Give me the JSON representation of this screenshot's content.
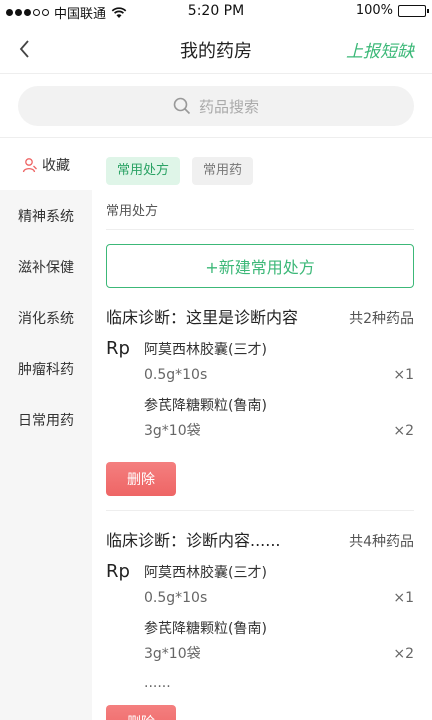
{
  "status": {
    "carrier": "中国联通",
    "time": "5:20 PM",
    "battery": "100%"
  },
  "nav": {
    "title": "我的药房",
    "report": "上报短缺"
  },
  "search": {
    "placeholder": "药品搜索"
  },
  "sidebar": {
    "items": [
      {
        "label": "收藏",
        "active": true
      },
      {
        "label": "精神系统"
      },
      {
        "label": "滋补保健"
      },
      {
        "label": "消化系统"
      },
      {
        "label": "肿瘤科药"
      },
      {
        "label": "日常用药"
      }
    ]
  },
  "tabs": [
    {
      "label": "常用处方"
    },
    {
      "label": "常用药"
    }
  ],
  "section_label": "常用处方",
  "new_button": "+新建常用处方",
  "cards": [
    {
      "diagnosis": "临床诊断：这里是诊断内容",
      "count": "共2种药品",
      "rp": "Rp",
      "drugs": [
        {
          "name": "阿莫西林胶囊(三才)",
          "spec": "0.5g*10s",
          "qty": "×1"
        },
        {
          "name": "参芪降糖颗粒(鲁南)",
          "spec": "3g*10袋",
          "qty": "×2"
        }
      ],
      "delete": "删除"
    },
    {
      "diagnosis": "临床诊断：诊断内容......",
      "count": "共4种药品",
      "rp": "Rp",
      "drugs": [
        {
          "name": "阿莫西林胶囊(三才)",
          "spec": "0.5g*10s",
          "qty": "×1"
        },
        {
          "name": "参芪降糖颗粒(鲁南)",
          "spec": "3g*10袋",
          "qty": "×2"
        }
      ],
      "more": "......",
      "delete": "删除"
    }
  ],
  "colors": {
    "accent": "#3cb878",
    "danger": "#ee6565"
  }
}
